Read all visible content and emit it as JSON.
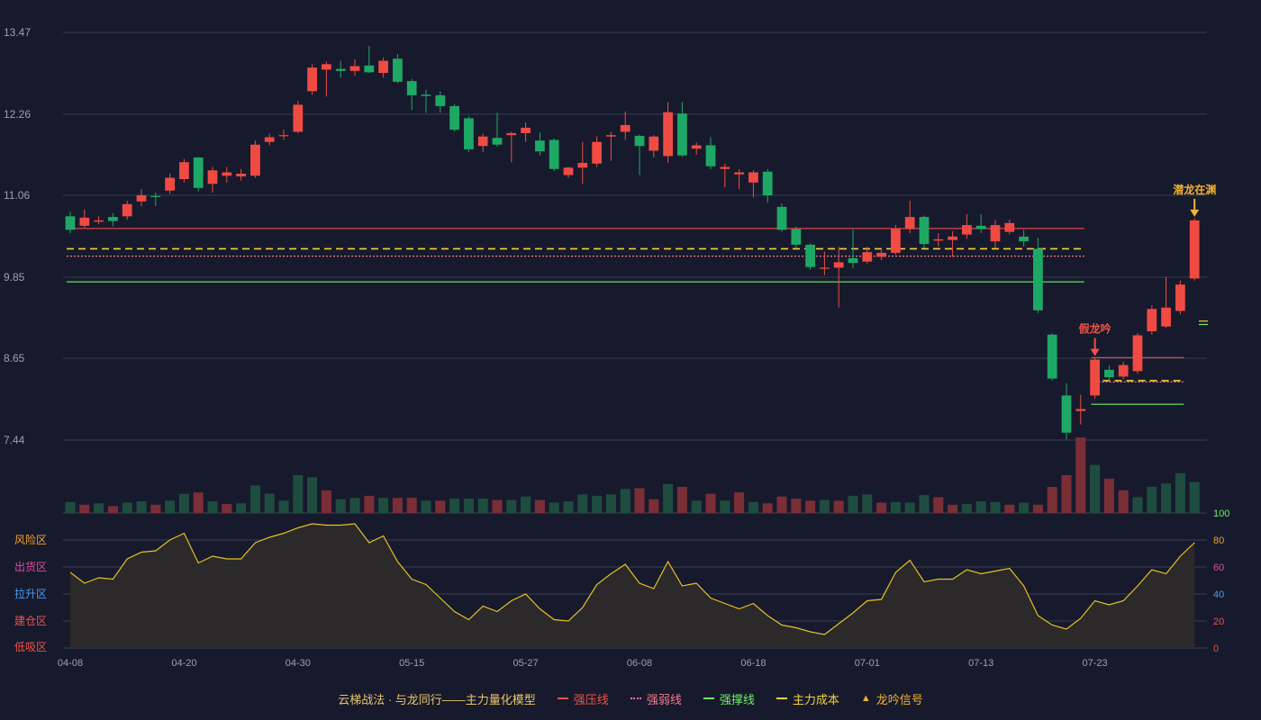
{
  "chart_data": {
    "type": "candlestick",
    "price_axis": {
      "ticks": [
        "13.47",
        "12.26",
        "11.06",
        "9.85",
        "8.65",
        "7.44"
      ],
      "ylim": [
        7.44,
        13.47
      ]
    },
    "x_tick_labels": [
      "04-08",
      "04-20",
      "04-30",
      "05-15",
      "05-27",
      "06-08",
      "06-18",
      "07-01",
      "07-13",
      "07-23"
    ],
    "x_tick_index": [
      0,
      8,
      16,
      24,
      32,
      40,
      48,
      56,
      64,
      72
    ],
    "candles": [
      [
        10.75,
        10.55,
        10.82,
        10.5
      ],
      [
        10.61,
        10.73,
        10.85,
        10.58
      ],
      [
        10.67,
        10.69,
        10.75,
        10.63
      ],
      [
        10.74,
        10.68,
        10.8,
        10.6
      ],
      [
        10.75,
        10.93,
        10.98,
        10.7
      ],
      [
        10.97,
        11.06,
        11.15,
        10.9
      ],
      [
        11.05,
        11.04,
        11.1,
        10.9
      ],
      [
        11.13,
        11.32,
        11.38,
        11.08
      ],
      [
        11.3,
        11.55,
        11.6,
        11.25
      ],
      [
        11.62,
        11.17,
        11.63,
        11.12
      ],
      [
        11.23,
        11.43,
        11.48,
        11.1
      ],
      [
        11.35,
        11.4,
        11.48,
        11.25
      ],
      [
        11.34,
        11.38,
        11.45,
        11.28
      ],
      [
        11.35,
        11.81,
        11.87,
        11.32
      ],
      [
        11.85,
        11.92,
        11.97,
        11.8
      ],
      [
        11.94,
        11.95,
        12.03,
        11.88
      ],
      [
        12.0,
        12.4,
        12.46,
        11.98
      ],
      [
        12.6,
        12.95,
        13.0,
        12.55
      ],
      [
        12.92,
        13.0,
        13.04,
        12.52
      ],
      [
        12.93,
        12.9,
        13.05,
        12.8
      ],
      [
        12.9,
        12.97,
        13.07,
        12.83
      ],
      [
        12.98,
        12.88,
        13.27,
        12.87
      ],
      [
        12.87,
        13.05,
        13.1,
        12.8
      ],
      [
        13.08,
        12.74,
        13.15,
        12.72
      ],
      [
        12.75,
        12.54,
        12.78,
        12.32
      ],
      [
        12.55,
        12.53,
        12.62,
        12.28
      ],
      [
        12.54,
        12.38,
        12.6,
        12.28
      ],
      [
        12.38,
        12.03,
        12.41,
        12.0
      ],
      [
        12.2,
        11.74,
        12.23,
        11.7
      ],
      [
        11.79,
        11.93,
        11.97,
        11.7
      ],
      [
        11.91,
        11.81,
        12.28,
        11.78
      ],
      [
        11.95,
        11.98,
        12.0,
        11.55
      ],
      [
        11.98,
        12.06,
        12.14,
        11.85
      ],
      [
        11.87,
        11.71,
        11.99,
        11.65
      ],
      [
        11.88,
        11.45,
        11.9,
        11.42
      ],
      [
        11.36,
        11.47,
        11.48,
        11.32
      ],
      [
        11.47,
        11.54,
        11.85,
        11.23
      ],
      [
        11.53,
        11.85,
        11.93,
        11.48
      ],
      [
        11.93,
        11.95,
        12.0,
        11.57
      ],
      [
        12.0,
        12.1,
        12.3,
        11.88
      ],
      [
        11.94,
        11.79,
        11.96,
        11.36
      ],
      [
        11.72,
        11.93,
        11.95,
        11.62
      ],
      [
        11.64,
        12.29,
        12.44,
        11.54
      ],
      [
        12.27,
        11.65,
        12.44,
        11.63
      ],
      [
        11.75,
        11.8,
        11.84,
        11.66
      ],
      [
        11.8,
        11.49,
        11.92,
        11.45
      ],
      [
        11.45,
        11.48,
        11.53,
        11.18
      ],
      [
        11.37,
        11.4,
        11.45,
        11.15
      ],
      [
        11.25,
        11.4,
        11.43,
        11.03
      ],
      [
        11.41,
        11.06,
        11.45,
        10.95
      ],
      [
        10.89,
        10.55,
        10.94,
        10.52
      ],
      [
        10.56,
        10.33,
        10.6,
        10.28
      ],
      [
        10.33,
        10.0,
        10.35,
        9.96
      ],
      [
        9.98,
        9.99,
        10.23,
        9.88
      ],
      [
        9.99,
        10.07,
        10.3,
        9.4
      ],
      [
        10.13,
        10.06,
        10.55,
        9.98
      ],
      [
        10.08,
        10.22,
        10.3,
        10.05
      ],
      [
        10.15,
        10.21,
        10.27,
        10.1
      ],
      [
        10.21,
        10.56,
        10.62,
        10.18
      ],
      [
        10.56,
        10.74,
        10.98,
        10.5
      ],
      [
        10.74,
        10.34,
        10.76,
        10.28
      ],
      [
        10.39,
        10.41,
        10.5,
        10.3
      ],
      [
        10.4,
        10.45,
        10.53,
        10.15
      ],
      [
        10.48,
        10.62,
        10.78,
        10.42
      ],
      [
        10.61,
        10.56,
        10.78,
        10.5
      ],
      [
        10.38,
        10.62,
        10.7,
        10.28
      ],
      [
        10.52,
        10.65,
        10.7,
        10.48
      ],
      [
        10.45,
        10.38,
        10.55,
        10.3
      ],
      [
        10.27,
        9.36,
        10.43,
        9.32
      ],
      [
        9.0,
        8.35,
        9.02,
        8.32
      ],
      [
        8.1,
        7.55,
        8.28,
        7.45
      ],
      [
        7.87,
        7.9,
        8.11,
        7.67
      ],
      [
        8.1,
        8.63,
        8.66,
        8.05
      ],
      [
        8.48,
        8.37,
        8.54,
        8.3
      ],
      [
        8.38,
        8.55,
        8.6,
        8.34
      ],
      [
        8.46,
        8.99,
        9.02,
        8.42
      ],
      [
        9.05,
        9.38,
        9.43,
        9.0
      ],
      [
        9.12,
        9.4,
        9.85,
        9.1
      ],
      [
        9.35,
        9.74,
        9.8,
        9.3
      ],
      [
        9.83,
        10.69,
        10.72,
        9.8
      ]
    ],
    "volume": [
      [
        16,
        "down"
      ],
      [
        12,
        "up"
      ],
      [
        14,
        "down"
      ],
      [
        10,
        "up"
      ],
      [
        15,
        "down"
      ],
      [
        17,
        "down"
      ],
      [
        12,
        "up"
      ],
      [
        18,
        "down"
      ],
      [
        28,
        "down"
      ],
      [
        30,
        "up"
      ],
      [
        17,
        "down"
      ],
      [
        13,
        "up"
      ],
      [
        14,
        "down"
      ],
      [
        40,
        "down"
      ],
      [
        28,
        "down"
      ],
      [
        18,
        "down"
      ],
      [
        55,
        "down"
      ],
      [
        52,
        "down"
      ],
      [
        33,
        "up"
      ],
      [
        20,
        "down"
      ],
      [
        22,
        "down"
      ],
      [
        25,
        "up"
      ],
      [
        22,
        "down"
      ],
      [
        22,
        "up"
      ],
      [
        22,
        "up"
      ],
      [
        18,
        "down"
      ],
      [
        18,
        "up"
      ],
      [
        21,
        "down"
      ],
      [
        21,
        "down"
      ],
      [
        21,
        "down"
      ],
      [
        19,
        "up"
      ],
      [
        19,
        "down"
      ],
      [
        24,
        "down"
      ],
      [
        19,
        "up"
      ],
      [
        15,
        "down"
      ],
      [
        17,
        "down"
      ],
      [
        27,
        "down"
      ],
      [
        25,
        "down"
      ],
      [
        27,
        "down"
      ],
      [
        35,
        "down"
      ],
      [
        36,
        "up"
      ],
      [
        20,
        "up"
      ],
      [
        42,
        "down"
      ],
      [
        38,
        "up"
      ],
      [
        18,
        "down"
      ],
      [
        28,
        "up"
      ],
      [
        18,
        "down"
      ],
      [
        30,
        "up"
      ],
      [
        16,
        "down"
      ],
      [
        14,
        "up"
      ],
      [
        24,
        "up"
      ],
      [
        21,
        "up"
      ],
      [
        18,
        "up"
      ],
      [
        19,
        "down"
      ],
      [
        18,
        "up"
      ],
      [
        25,
        "down"
      ],
      [
        27,
        "down"
      ],
      [
        15,
        "up"
      ],
      [
        16,
        "down"
      ],
      [
        15,
        "down"
      ],
      [
        26,
        "down"
      ],
      [
        23,
        "up"
      ],
      [
        12,
        "up"
      ],
      [
        13,
        "down"
      ],
      [
        17,
        "down"
      ],
      [
        16,
        "down"
      ],
      [
        12,
        "up"
      ],
      [
        15,
        "down"
      ],
      [
        12,
        "up"
      ],
      [
        38,
        "up"
      ],
      [
        55,
        "up"
      ],
      [
        110,
        "up"
      ],
      [
        70,
        "down"
      ],
      [
        50,
        "up"
      ],
      [
        33,
        "up"
      ],
      [
        23,
        "down"
      ],
      [
        38,
        "down"
      ],
      [
        43,
        "down"
      ],
      [
        58,
        "down"
      ],
      [
        45,
        "down"
      ]
    ],
    "oscillator": {
      "ticks": [
        "100",
        "80",
        "60",
        "40",
        "20",
        "0"
      ],
      "zones": [
        "风险区",
        "出货区",
        "拉升区",
        "建仓区",
        "低吸区"
      ],
      "values": [
        56,
        48,
        52,
        51,
        66,
        71,
        72,
        80,
        85,
        63,
        68,
        66,
        66,
        78,
        82,
        85,
        89,
        92,
        91,
        91,
        92,
        78,
        83,
        64,
        51,
        47,
        37,
        27,
        21,
        31,
        27,
        35,
        40,
        29,
        21,
        20,
        30,
        47,
        55,
        62,
        48,
        44,
        64,
        46,
        48,
        37,
        33,
        29,
        33,
        24,
        17,
        15,
        12,
        10,
        18,
        26,
        35,
        36,
        56,
        65,
        49,
        51,
        51,
        58,
        55,
        57,
        59,
        46,
        24,
        17,
        14,
        22,
        35,
        32,
        35,
        46,
        58,
        55,
        68,
        78
      ]
    },
    "lines": [
      {
        "name": "强压线",
        "value": 10.57,
        "from": 0,
        "to": 71,
        "style": "solid"
      },
      {
        "name": "主力成本",
        "value": 10.27,
        "from": 0,
        "to": 71,
        "style": "dashed"
      },
      {
        "name": "强弱线",
        "value": 10.16,
        "from": 0,
        "to": 71,
        "style": "dotted"
      },
      {
        "name": "强撑线",
        "value": 9.78,
        "from": 0,
        "to": 71,
        "style": "solid"
      },
      {
        "name": "强压线",
        "value": 8.66,
        "from": 72,
        "to": 78,
        "style": "solid"
      },
      {
        "name": "主力成本",
        "value": 8.32,
        "from": 72,
        "to": 78,
        "style": "dashed"
      },
      {
        "name": "强弱线",
        "value": 8.3,
        "from": 72,
        "to": 78,
        "style": "dotted"
      },
      {
        "name": "强撑线",
        "value": 7.97,
        "from": 72,
        "to": 78,
        "style": "solid"
      }
    ],
    "signals": [
      {
        "index": 72,
        "label": "假龙吟",
        "color": "#f0524a",
        "at": 8.63
      },
      {
        "index": 79,
        "label": "潜龙在渊",
        "color": "#f1b232",
        "at": 10.69
      }
    ],
    "legend": {
      "title": "云梯战法 · 与龙同行——主力量化模型",
      "items": [
        {
          "label": "强压线",
          "color": "#f0524a",
          "style": "solid"
        },
        {
          "label": "强弱线",
          "color": "#f07a8a",
          "style": "dotted"
        },
        {
          "label": "强撑线",
          "color": "#6df06a",
          "style": "solid"
        },
        {
          "label": "主力成本",
          "color": "#f5d23a",
          "style": "dash"
        },
        {
          "label": "龙吟信号",
          "color": "#f1b232",
          "style": "tri"
        }
      ]
    },
    "colors": {
      "up": "#ef4b43",
      "down": "#1ea866",
      "vol_up": "#7a2e36",
      "vol_down": "#1e4d3f",
      "grid": "#3a3e52",
      "osc": "#e6c026",
      "osc_fill": "#2e2b2a"
    }
  }
}
